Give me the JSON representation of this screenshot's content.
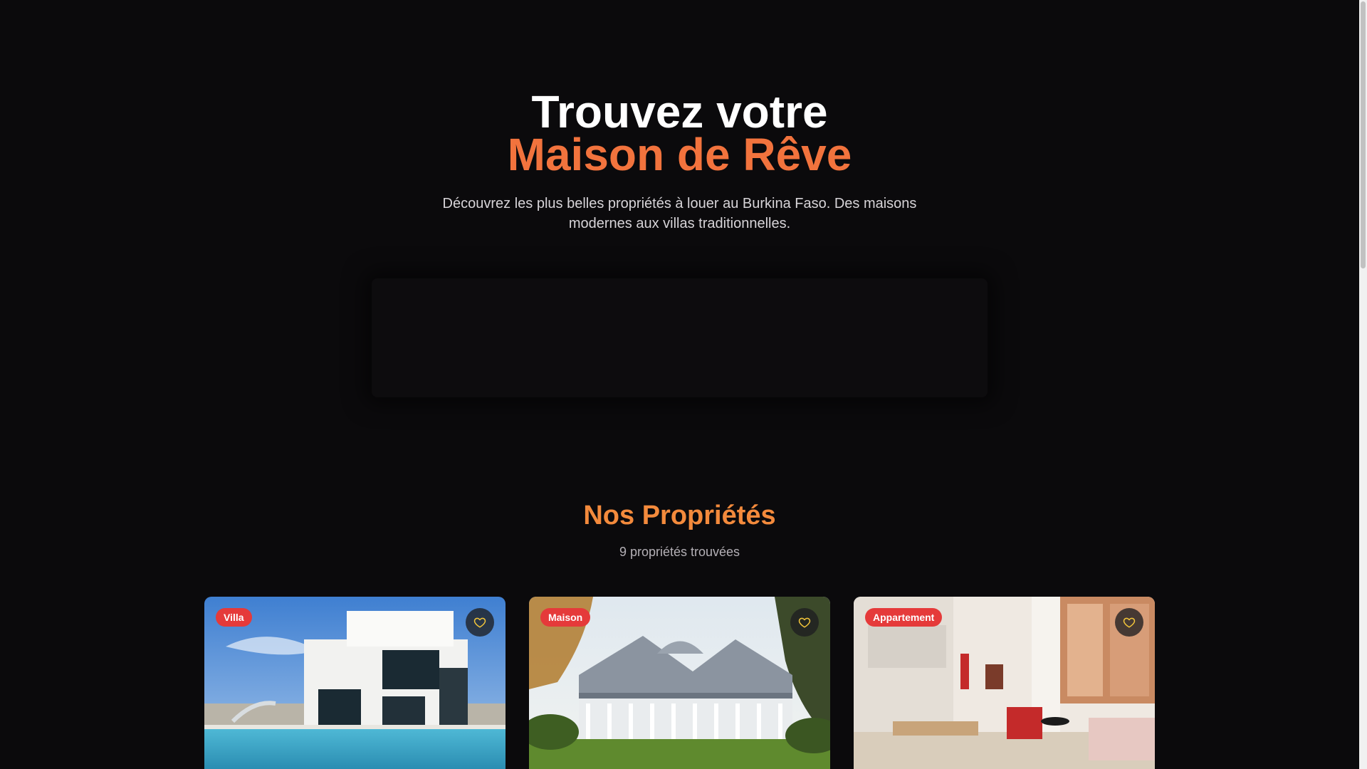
{
  "hero": {
    "title_line1": "Trouvez votre",
    "title_line2": "Maison de Rêve",
    "subtitle": "Découvrez les plus belles propriétés à louer au Burkina Faso. Des maisons modernes aux villas traditionnelles."
  },
  "properties": {
    "title": "Nos Propriétés",
    "count_label": "9 propriétés trouvées",
    "cards": [
      {
        "badge": "Villa",
        "favorite_icon": "heart-icon"
      },
      {
        "badge": "Maison",
        "favorite_icon": "heart-icon"
      },
      {
        "badge": "Appartement",
        "favorite_icon": "heart-icon"
      }
    ]
  },
  "colors": {
    "background": "#0b0a0c",
    "accent_title": "#f2733d",
    "section_title": "#f38a3c",
    "badge": "#e53a3a"
  }
}
